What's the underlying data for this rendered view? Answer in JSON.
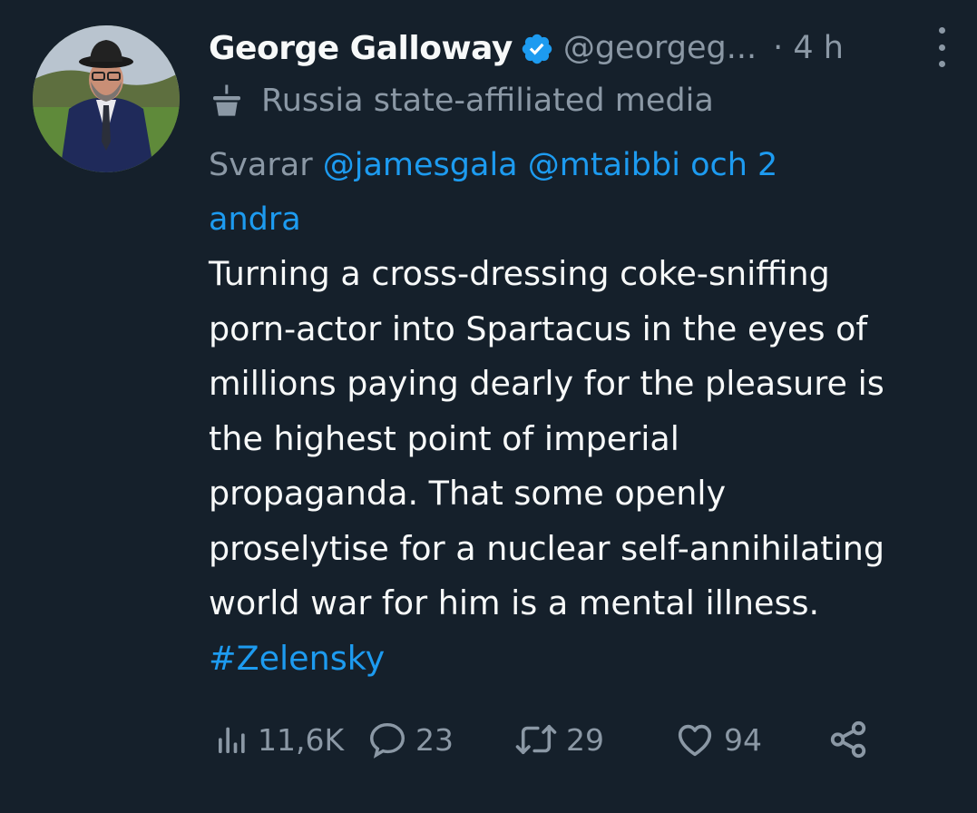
{
  "author": {
    "display_name": "George Galloway",
    "handle": "@georgeg...",
    "time": "· 4 h",
    "verified_icon": "verified-badge-icon",
    "avatar": "profile-photo"
  },
  "affiliation": {
    "icon": "podium-icon",
    "label": "Russia state-affiliated media"
  },
  "reply": {
    "prefix": "Svarar",
    "mention_1": "@jamesgala",
    "mention_2": "@mtaibbi",
    "others": "och 2",
    "others_2": "andra"
  },
  "tweet": {
    "lines": [
      "Turning a cross-dressing coke-sniffing",
      "porn-actor into Spartacus in the eyes of",
      "millions paying dearly for the pleasure is",
      "the highest point of imperial",
      "propaganda. That some openly",
      "proselytise for a nuclear self-annihilating",
      "world war for him is a mental illness."
    ],
    "hashtag": "#Zelensky"
  },
  "actions": {
    "views": "11,6K",
    "replies": "23",
    "retweets": "29",
    "likes": "94"
  },
  "colors": {
    "background": "#15202b",
    "text": "#f7f9f9",
    "secondary": "#8b98a5",
    "accent": "#1d9bf0"
  }
}
